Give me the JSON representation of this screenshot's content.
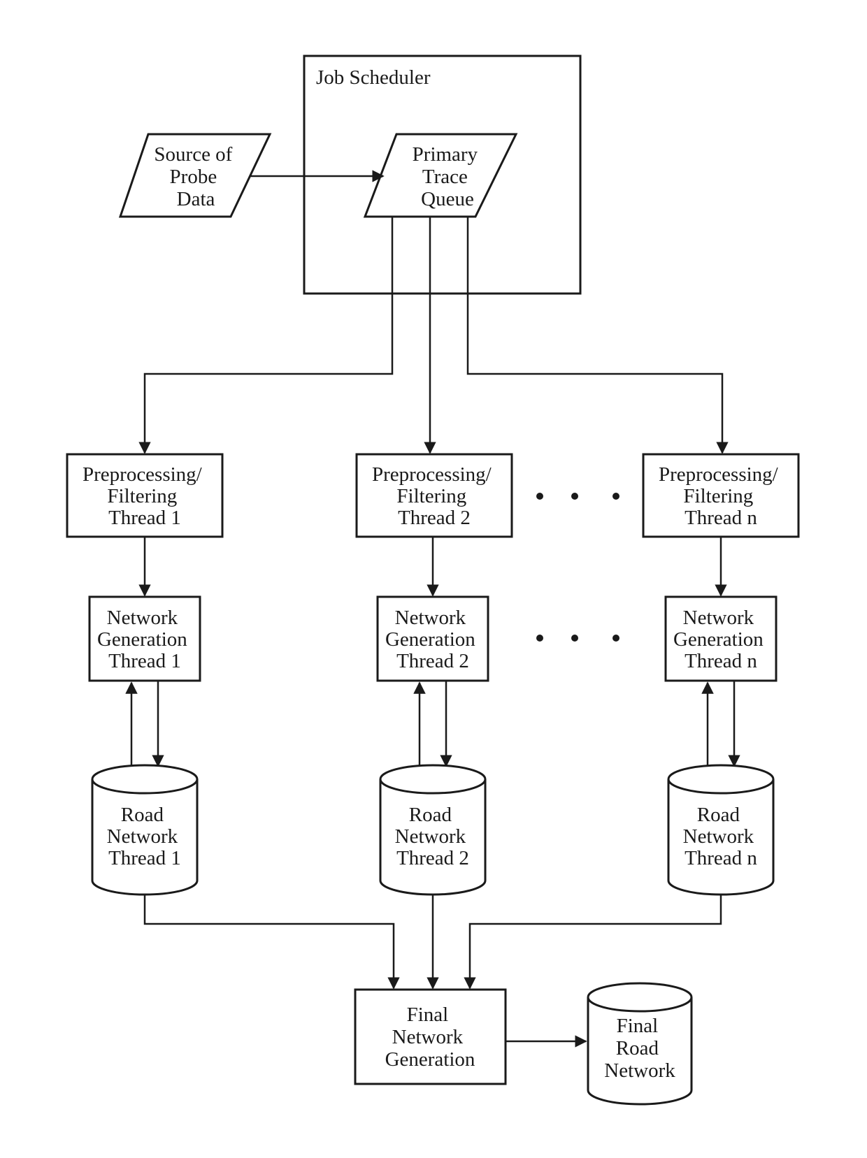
{
  "diagram": {
    "job_scheduler": {
      "label": "Job Scheduler"
    },
    "source": {
      "lines": [
        "Source of",
        "Probe",
        "Data"
      ]
    },
    "primary_queue": {
      "lines": [
        "Primary",
        "Trace",
        "Queue"
      ]
    },
    "preprocessing": [
      {
        "lines": [
          "Preprocessing/",
          "Filtering",
          "Thread 1"
        ]
      },
      {
        "lines": [
          "Preprocessing/",
          "Filtering",
          "Thread 2"
        ]
      },
      {
        "lines": [
          "Preprocessing/",
          "Filtering",
          "Thread n"
        ]
      }
    ],
    "network_generation": [
      {
        "lines": [
          "Network",
          "Generation",
          "Thread 1"
        ]
      },
      {
        "lines": [
          "Network",
          "Generation",
          "Thread 2"
        ]
      },
      {
        "lines": [
          "Network",
          "Generation",
          "Thread n"
        ]
      }
    ],
    "road_network": [
      {
        "lines": [
          "Road",
          "Network",
          "Thread 1"
        ]
      },
      {
        "lines": [
          "Road",
          "Network",
          "Thread 2"
        ]
      },
      {
        "lines": [
          "Road",
          "Network",
          "Thread n"
        ]
      }
    ],
    "final_generation": {
      "lines": [
        "Final",
        "Network",
        "Generation"
      ]
    },
    "final_road_network": {
      "lines": [
        "Final",
        "Road",
        "Network"
      ]
    },
    "ellipsis_symbol": "• • •"
  }
}
